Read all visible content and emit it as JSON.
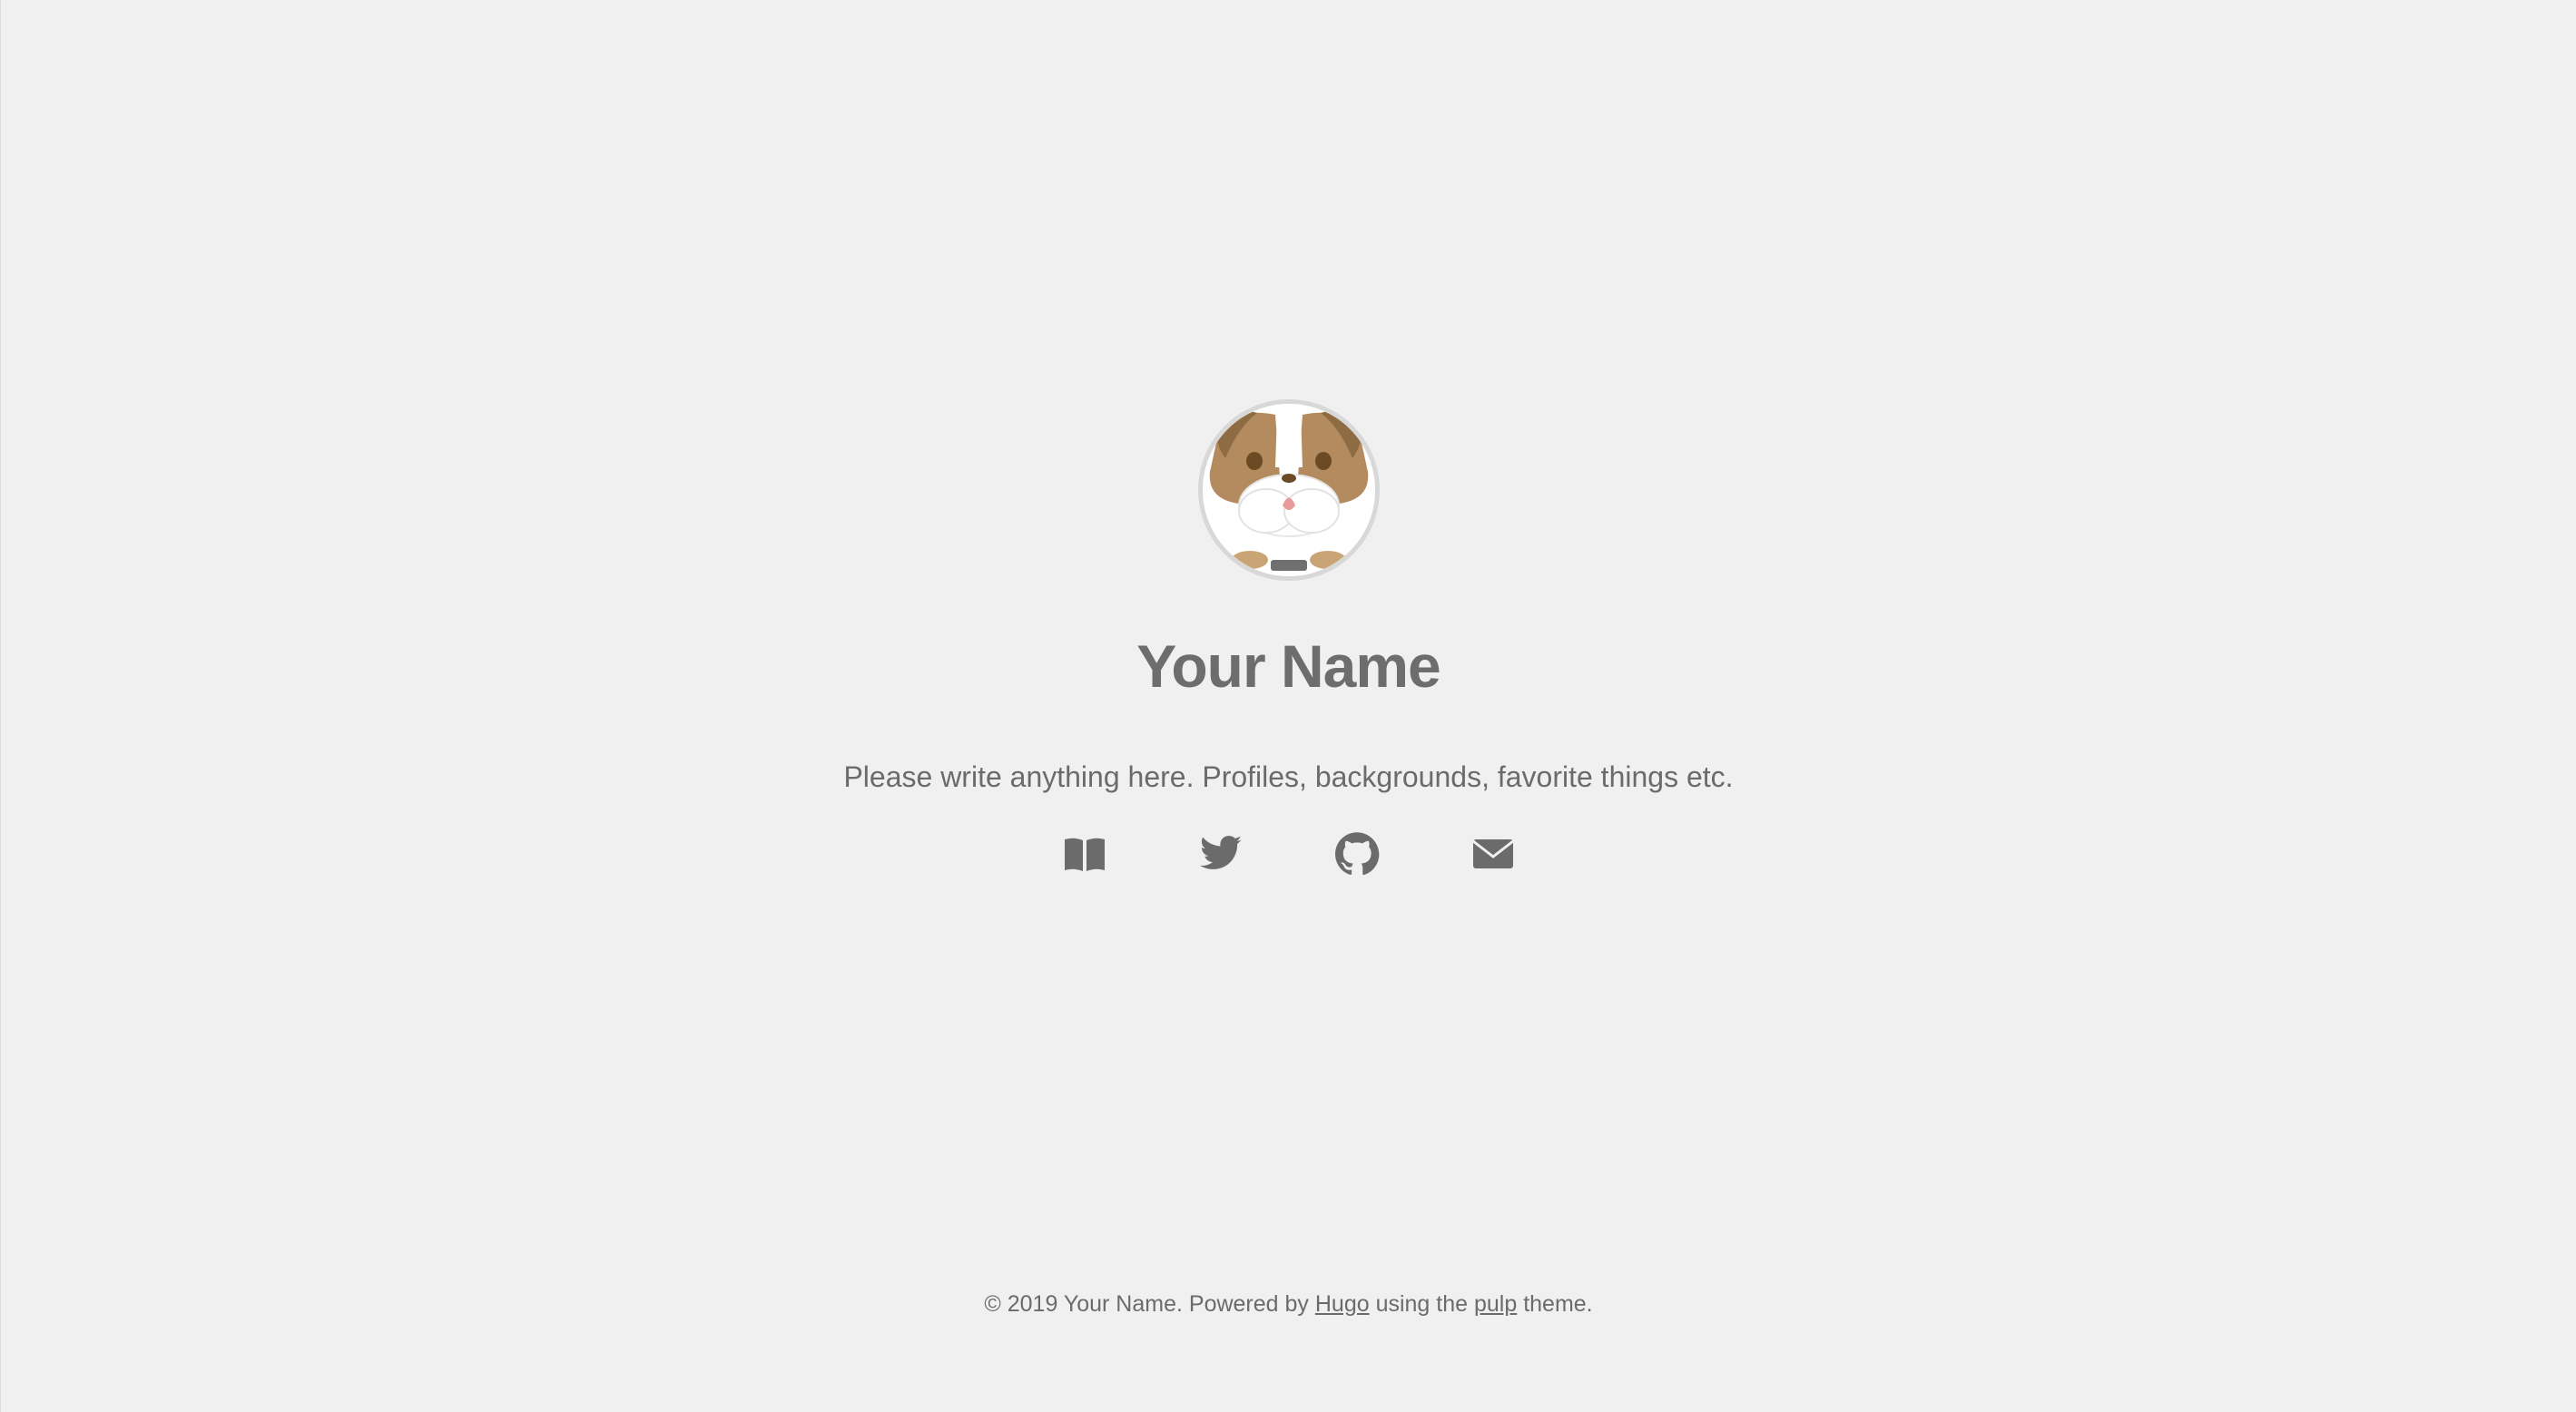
{
  "profile": {
    "name": "Your Name",
    "bio": "Please write anything here. Profiles, backgrounds, favorite things etc.",
    "avatar_alt": "bulldog avatar"
  },
  "links": [
    {
      "icon": "book-icon",
      "label": "Blog"
    },
    {
      "icon": "twitter-icon",
      "label": "Twitter"
    },
    {
      "icon": "github-icon",
      "label": "GitHub"
    },
    {
      "icon": "envelope-icon",
      "label": "Email"
    }
  ],
  "footer": {
    "prefix": "© 2019 Your Name. Powered by ",
    "hugo_link": "Hugo",
    "middle": " using the ",
    "theme_link": "pulp",
    "suffix": " theme."
  },
  "colors": {
    "background": "#f0f0f0",
    "text": "#6b6b6b",
    "avatar_border": "#d8d8d8"
  }
}
